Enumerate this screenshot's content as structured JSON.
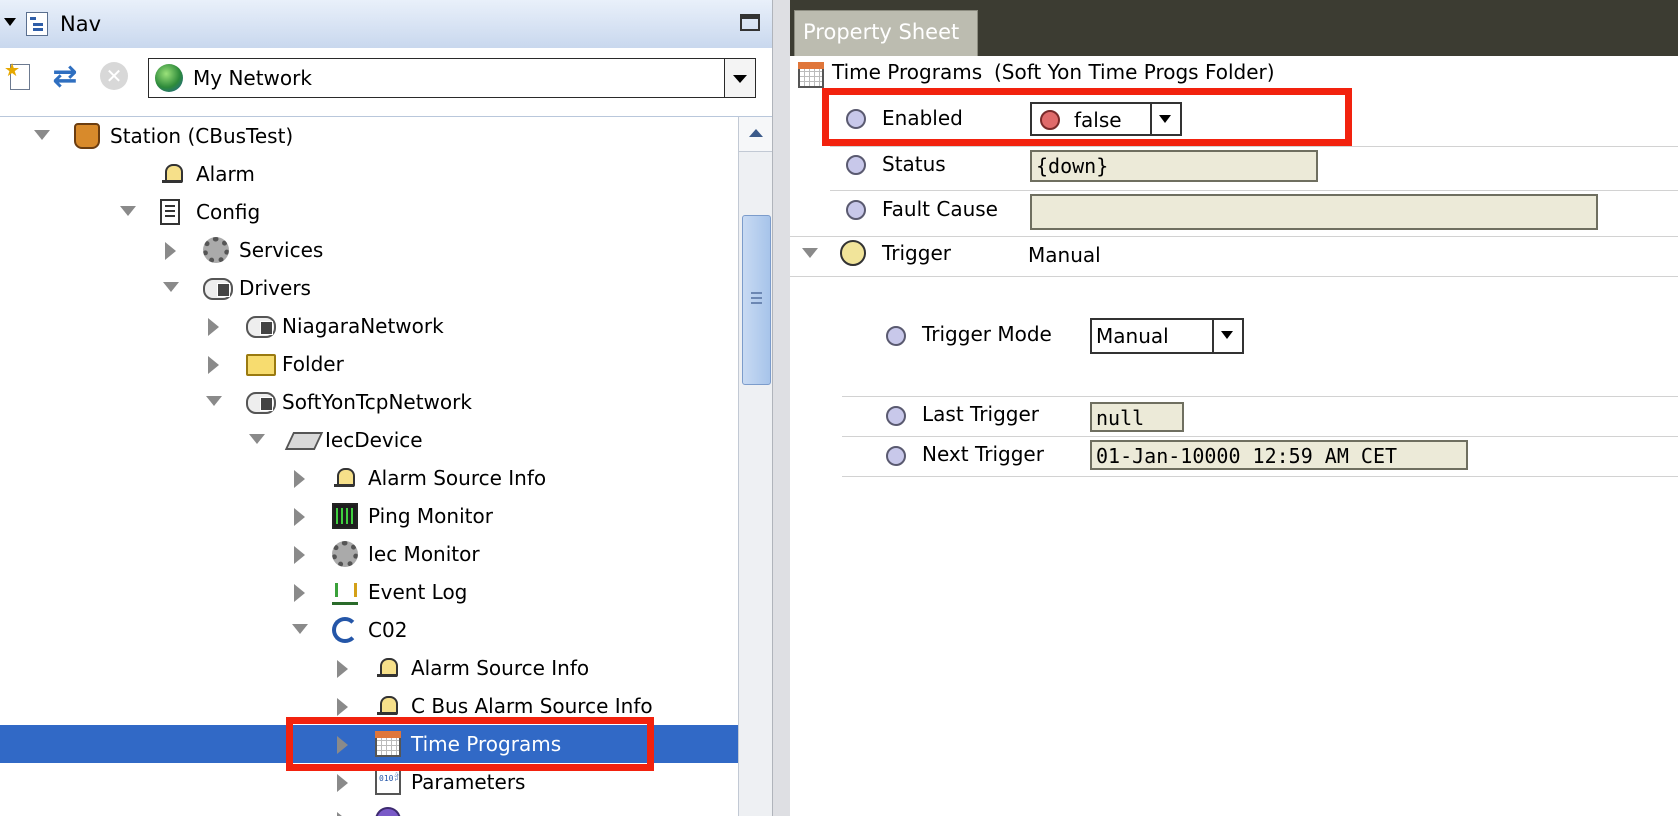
{
  "nav": {
    "title": "Nav",
    "network_select": {
      "value": "My Network"
    },
    "tree": [
      {
        "label": "Station (CBusTest)",
        "icon": "station-icon",
        "state": "open"
      },
      {
        "label": "Alarm",
        "icon": "alarm-bell-icon",
        "state": "leaf"
      },
      {
        "label": "Config",
        "icon": "config-icon",
        "state": "open"
      },
      {
        "label": "Services",
        "icon": "gear-icon",
        "state": "closed"
      },
      {
        "label": "Drivers",
        "icon": "network-cloud-icon",
        "state": "open"
      },
      {
        "label": "NiagaraNetwork",
        "icon": "network-cloud-icon",
        "state": "closed"
      },
      {
        "label": "Folder",
        "icon": "folder-icon",
        "state": "closed"
      },
      {
        "label": "SoftYonTcpNetwork",
        "icon": "network-cloud-icon",
        "state": "open"
      },
      {
        "label": "IecDevice",
        "icon": "device-icon",
        "state": "open"
      },
      {
        "label": "Alarm Source Info",
        "icon": "alarm-bell-icon",
        "state": "closed"
      },
      {
        "label": "Ping Monitor",
        "icon": "ping-chart-icon",
        "state": "closed"
      },
      {
        "label": "Iec Monitor",
        "icon": "gear-icon",
        "state": "closed"
      },
      {
        "label": "Event Log",
        "icon": "event-log-icon",
        "state": "closed"
      },
      {
        "label": "C02",
        "icon": "cbus-icon",
        "state": "open"
      },
      {
        "label": "Alarm Source Info",
        "icon": "alarm-bell-icon",
        "state": "closed"
      },
      {
        "label": "C Bus Alarm Source Info",
        "icon": "alarm-bell-icon",
        "state": "closed"
      },
      {
        "label": "Time Programs",
        "icon": "calendar-icon",
        "state": "closed",
        "selected": true
      },
      {
        "label": "Parameters",
        "icon": "parameters-icon",
        "state": "closed"
      },
      {
        "label": "",
        "icon": "point-icon",
        "state": "closed"
      }
    ]
  },
  "property_sheet": {
    "tab_label": "Property Sheet",
    "header": {
      "name": "Time Programs",
      "type": "(Soft Yon Time Progs Folder)"
    },
    "enabled": {
      "label": "Enabled",
      "value": "false"
    },
    "status": {
      "label": "Status",
      "value": "{down}"
    },
    "fault_cause": {
      "label": "Fault Cause",
      "value": ""
    },
    "trigger": {
      "label": "Trigger",
      "summary": "Manual",
      "mode": {
        "label": "Trigger Mode",
        "value": "Manual"
      },
      "last": {
        "label": "Last Trigger",
        "value": "null"
      },
      "next": {
        "label": "Next Trigger",
        "value": "01-Jan-10000 12:59 AM CET"
      }
    }
  },
  "colors": {
    "selection": "#3169c6",
    "highlight": "#f2220e",
    "tab_bar": "#3c3c32"
  }
}
